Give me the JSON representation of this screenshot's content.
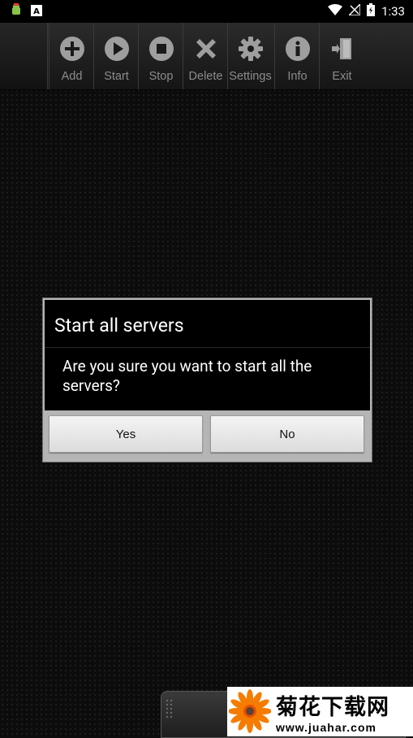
{
  "status_bar": {
    "time": "1:33",
    "icons": [
      "android-debug-icon",
      "app-notification-icon",
      "wifi-icon",
      "no-signal-icon",
      "battery-charging-icon"
    ]
  },
  "toolbar": {
    "items": [
      {
        "label": "Add",
        "icon": "add-icon"
      },
      {
        "label": "Start",
        "icon": "play-icon"
      },
      {
        "label": "Stop",
        "icon": "stop-icon"
      },
      {
        "label": "Delete",
        "icon": "delete-icon"
      },
      {
        "label": "Settings",
        "icon": "gear-icon"
      },
      {
        "label": "Info",
        "icon": "info-icon"
      },
      {
        "label": "Exit",
        "icon": "exit-icon"
      }
    ]
  },
  "dialog": {
    "title": "Start all servers",
    "message": "Are you sure you want to start all the servers?",
    "yes_label": "Yes",
    "no_label": "No"
  },
  "watermark": {
    "chinese": "菊花下载网",
    "url": "www.juahar.com"
  },
  "colors": {
    "background": "#0c0c0c",
    "toolbar_label": "#8c8c8c",
    "dialog_frame": "#b5b5b5"
  }
}
